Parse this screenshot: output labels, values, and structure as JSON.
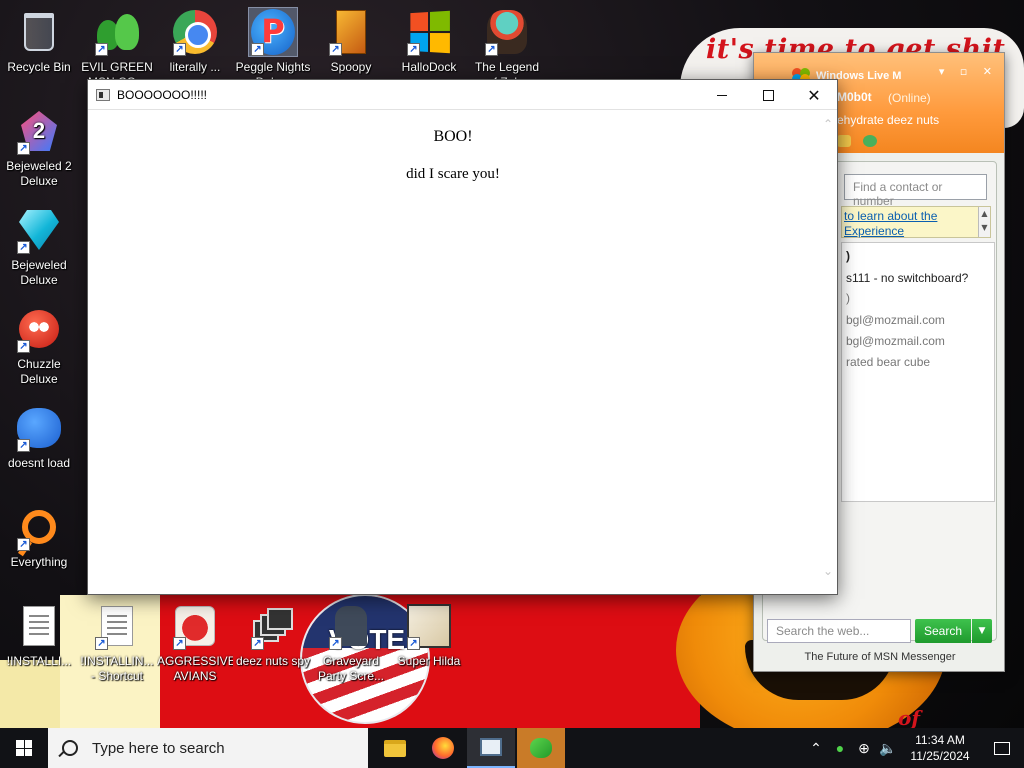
{
  "wallpaper": {
    "slogan": "it's time to get shit",
    "badge_text": "VOTE",
    "fragment": "of"
  },
  "desktop_icons": [
    {
      "label": "Recycle Bin",
      "icon": "recycle-bin-icon"
    },
    {
      "label": "EVIL GREEN MSN CO...",
      "icon": "msn-people-icon"
    },
    {
      "label": "literally ...",
      "icon": "chrome-icon"
    },
    {
      "label": "Peggle Nights Delu...",
      "icon": "peggle-icon"
    },
    {
      "label": "Spoopy",
      "icon": "spoopy-icon"
    },
    {
      "label": "HalloDock",
      "icon": "windows-logo-icon"
    },
    {
      "label": "The Legend of Zel...",
      "icon": "legend-character-icon"
    },
    {
      "label": "Bejeweled 2 Deluxe",
      "icon": "bejeweled-2-icon"
    },
    {
      "label": "Bejeweled Deluxe",
      "icon": "diamond-gem-icon"
    },
    {
      "label": "Chuzzle Deluxe",
      "icon": "chuzzle-icon"
    },
    {
      "label": "doesnt load",
      "icon": "blue-bird-icon"
    },
    {
      "label": "Everything",
      "icon": "everything-search-icon"
    },
    {
      "label": "!INSTALLI...",
      "icon": "document-icon"
    },
    {
      "label": "!INSTALLIN... - Shortcut",
      "icon": "document-icon"
    },
    {
      "label": "AGGRESSIVE AVIANS",
      "icon": "angry-bird-icon"
    },
    {
      "label": "deez nuts spy",
      "icon": "stacked-windows-icon"
    },
    {
      "label": "Graveyard Party Scre...",
      "icon": "graveyard-icon"
    },
    {
      "label": "Super Hilda",
      "icon": "super-hilda-icon"
    }
  ],
  "dialog": {
    "title": "BOOOOOOO!!!!!",
    "heading": "BOO!",
    "message": "did I scare you!",
    "close_glyph": "✕"
  },
  "msn": {
    "title": "Windows Live M",
    "username": "M0b0t",
    "status": "(Online)",
    "personal_message": "ehydrate deez nuts",
    "contact_search_placeholder": "Find a contact or number",
    "banner_line1": "to learn about the",
    "banner_line2": "Experience",
    "contacts": [
      ")",
      "s111 - no switchboard?",
      ")",
      "bgl@mozmail.com",
      "bgl@mozmail.com",
      "rated bear cube"
    ],
    "web_search_placeholder": "Search the web...",
    "search_button": "Search",
    "footer": "The Future of MSN Messenger"
  },
  "taskbar": {
    "search_placeholder": "Type here to search",
    "clock_time": "11:34 AM",
    "clock_date": "11/25/2024"
  }
}
